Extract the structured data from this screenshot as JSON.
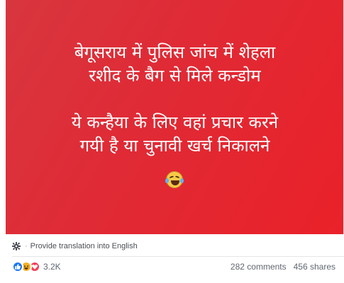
{
  "post": {
    "image_text": {
      "line1": "बेगूसराय में पुलिस जांच में शेहला",
      "line2": "रशीद के बैग से मिले कन्डोम",
      "line3": "ये कन्हैया के लिए वहां प्रचार करने",
      "line4": "गयी है या चुनावी खर्च निकालने"
    },
    "emoji": "laughing-crying-face",
    "translate_link": "Provide translation into English",
    "translate_separator": "·",
    "reactions": {
      "icons": [
        "like",
        "haha",
        "love"
      ],
      "count": "3.2K"
    },
    "comments": "282 comments",
    "shares": "456 shares"
  },
  "colors": {
    "image_bg": "#e02a35",
    "like": "#1877f2",
    "haha": "#f7b125",
    "love": "#f33e58"
  }
}
